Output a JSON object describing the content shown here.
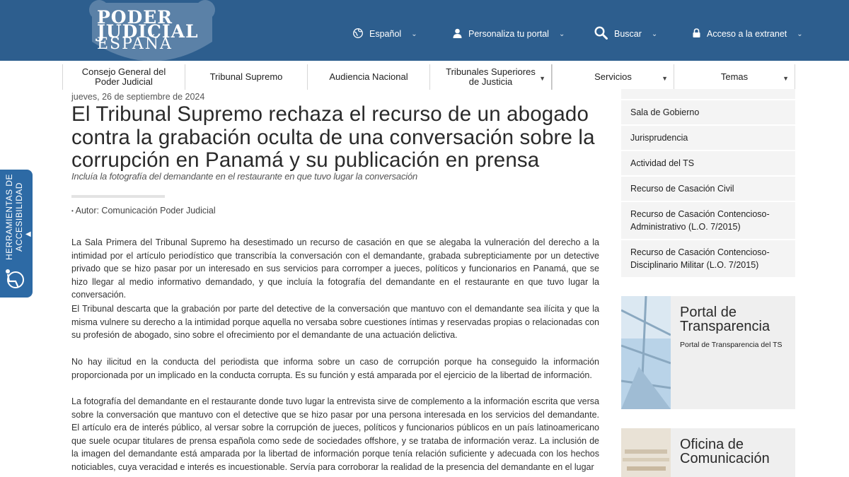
{
  "header": {
    "logo": {
      "line1": "PODER",
      "line2": "JUDICIAL",
      "line3": "ESPAÑA"
    },
    "nav": [
      {
        "label": "Español",
        "icon": "globe-icon"
      },
      {
        "label": "Personaliza tu portal",
        "icon": "user-icon"
      },
      {
        "label": "Buscar",
        "icon": "search-icon"
      },
      {
        "label": "Acceso a la extranet",
        "icon": "lock-icon"
      }
    ]
  },
  "mainnav": [
    {
      "label": "Consejo General del Poder Judicial"
    },
    {
      "label": "Tribunal Supremo"
    },
    {
      "label": "Audiencia Nacional"
    },
    {
      "label": "Tribunales Superiores de Justicia"
    },
    {
      "label": "Servicios"
    },
    {
      "label": "Temas"
    }
  ],
  "accessibility": {
    "label": "HERRAMIENTAS DE ACCESIBILIDAD",
    "icon": "accessibility-icon"
  },
  "article": {
    "date": "jueves, 26 de septiembre de 2024",
    "title": "El Tribunal Supremo rechaza el recurso de un abogado contra la grabación oculta de una conversación sobre la corrupción en Panamá y su publicación en prensa",
    "subtitle": "Incluía la fotografía del demandante en el restaurante en que tuvo lugar la conversación",
    "author": "Autor: Comunicación Poder Judicial",
    "paragraphs": [
      "La Sala Primera del Tribunal Supremo ha desestimado un recurso de casación en que se alegaba la vulneración del derecho a la intimidad por el artículo periodístico que transcribía la conversación con el demandante, grabada subrepticiamente por un detective privado que se hizo pasar por un interesado en sus servicios para corromper a jueces, políticos y funcionarios en Panamá, que se hizo llegar al medio informativo demandado, y que incluía la fotografía del demandante en el restaurante en que tuvo lugar la conversación.",
      "El Tribunal descarta que la grabación por parte del detective de la conversación que mantuvo con el demandante sea ilícita y que la misma vulnere su derecho a la intimidad porque aquella no versaba sobre cuestiones íntimas y reservadas propias o relacionadas con su profesión de abogado, sino sobre el ofrecimiento por el demandante de una actuación delictiva.",
      "No hay ilicitud en la conducta del periodista que informa sobre un caso de corrupción porque ha conseguido la información proporcionada por un implicado en la conducta corrupta. Es su función y está amparada por el ejercicio de la libertad de información.",
      "La fotografía del demandante en el restaurante donde tuvo lugar la entrevista sirve de complemento a la información escrita que versa sobre la conversación que mantuvo con el detective que se hizo pasar por una persona interesada en los servicios del demandante. El artículo era de interés público, al versar sobre la corrupción de jueces, políticos y funcionarios públicos en un país latinoamericano que suele ocupar titulares de prensa española como sede de sociedades offshore, y se trataba de información veraz. La inclusión de la imagen del demandante está amparada por la libertad de información porque tenía relación suficiente y adecuada con los hechos noticiables, cuya veracidad e interés es incuestionable. Servía para corroborar la realidad de la presencia del demandante en el lugar"
    ]
  },
  "sidebar": {
    "items": [
      {
        "label": "Sala de Gobierno"
      },
      {
        "label": "Jurisprudencia"
      },
      {
        "label": "Actividad del TS"
      },
      {
        "label": "Recurso de Casación Civil"
      },
      {
        "label": "Recurso de Casación Contencioso-Administrativo (L.O. 7/2015)"
      },
      {
        "label": "Recurso de Casación Contencioso-Disciplinario Militar (L.O. 7/2015)"
      }
    ],
    "cards": [
      {
        "title": "Portal de Transparencia",
        "subtitle": "Portal de Transparencia del TS"
      },
      {
        "title": "Oficina de Comunicación",
        "subtitle": ""
      }
    ]
  },
  "colors": {
    "header_bg": "#2d5e8e",
    "accessibility_bg": "#2d6aa5",
    "sidebar_bg": "#f4f4f4"
  }
}
